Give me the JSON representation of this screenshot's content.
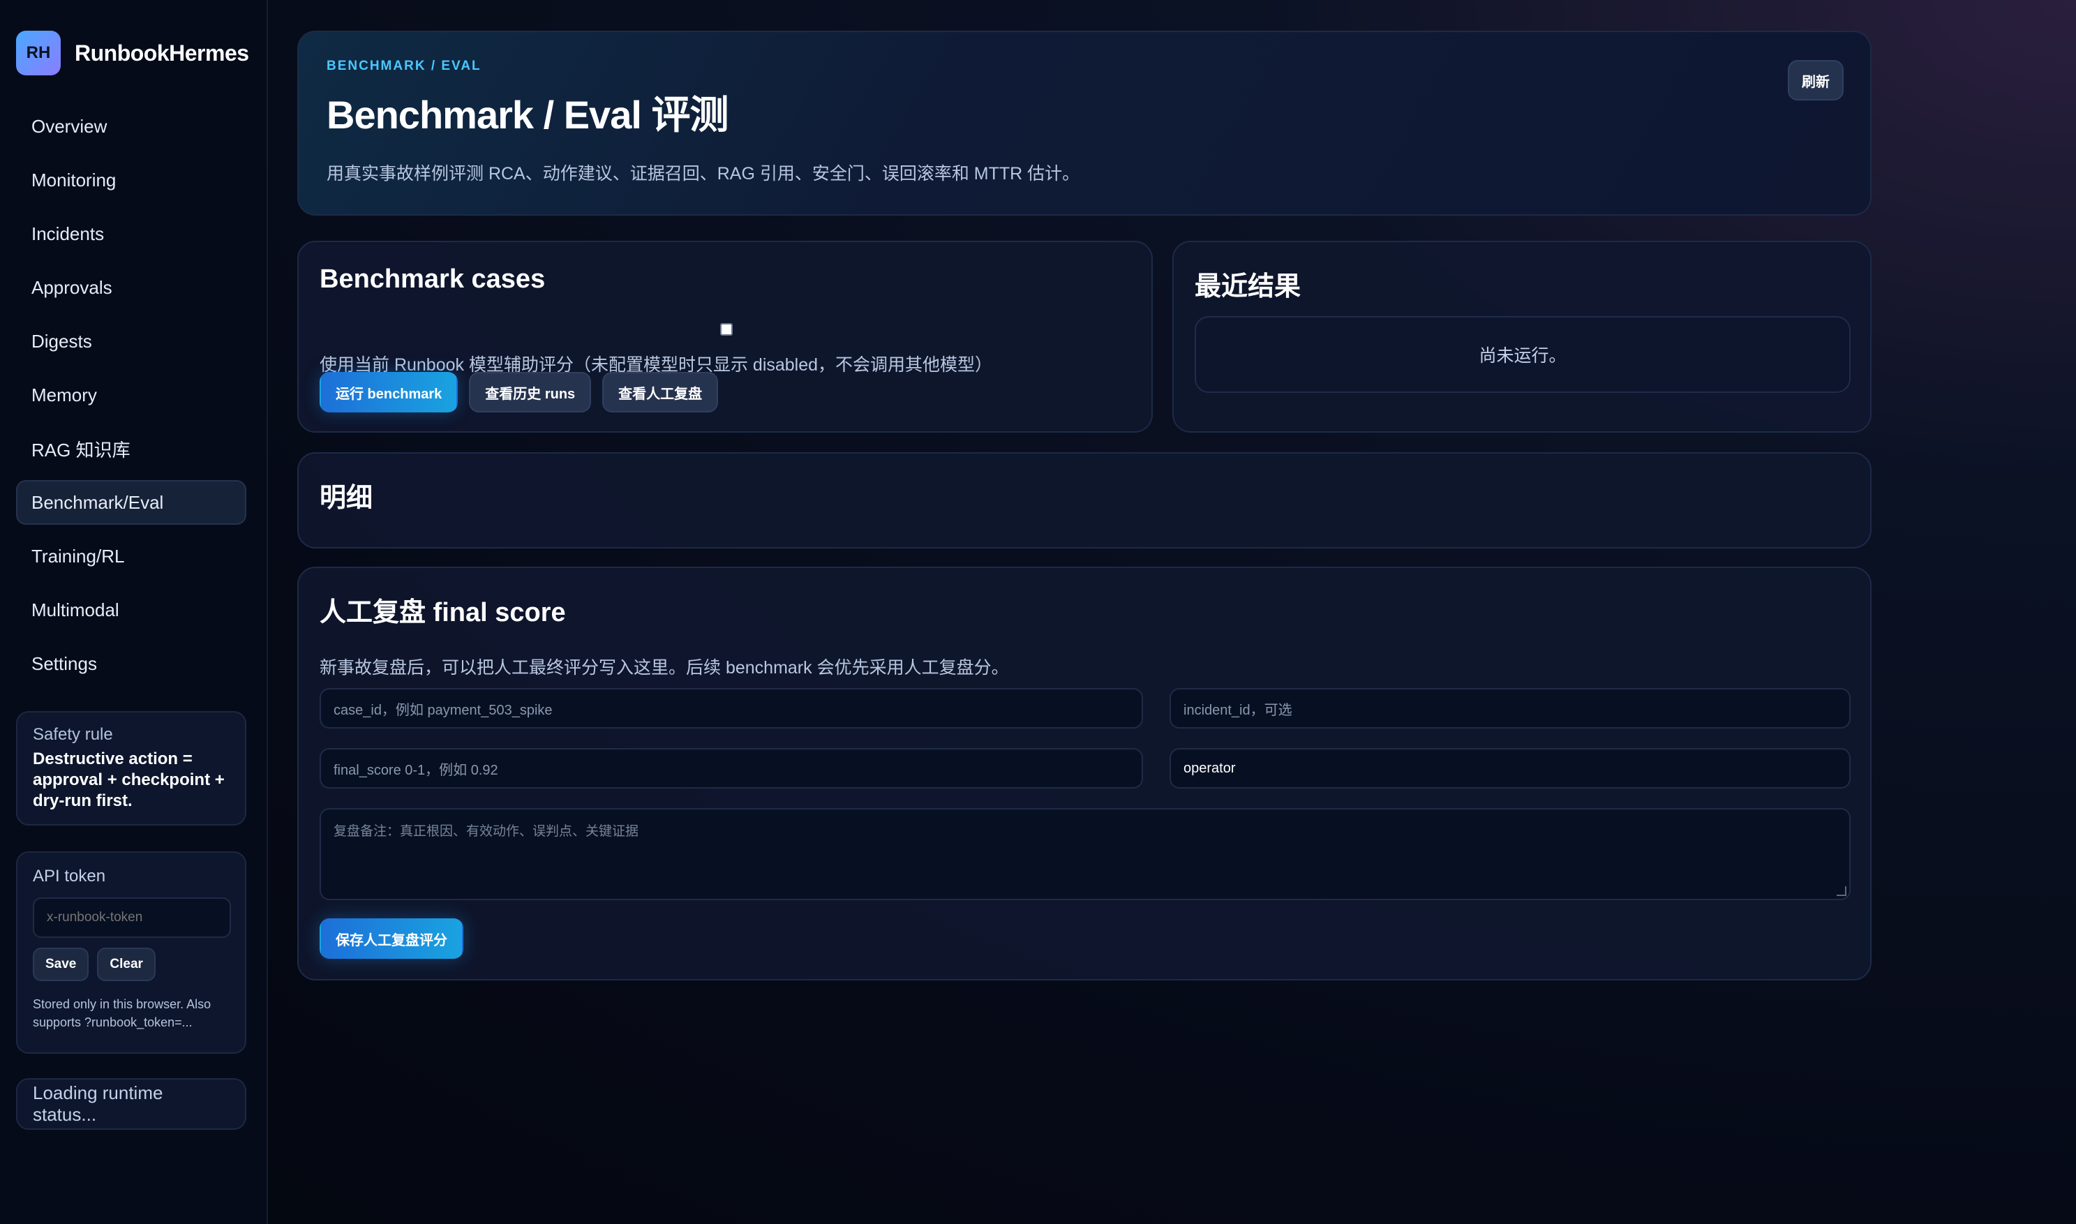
{
  "brand": {
    "logo": "RH",
    "name": "RunbookHermes"
  },
  "nav": [
    {
      "label": "Overview",
      "active": false
    },
    {
      "label": "Monitoring",
      "active": false
    },
    {
      "label": "Incidents",
      "active": false
    },
    {
      "label": "Approvals",
      "active": false
    },
    {
      "label": "Digests",
      "active": false
    },
    {
      "label": "Memory",
      "active": false
    },
    {
      "label": "RAG 知识库",
      "active": false
    },
    {
      "label": "Benchmark/Eval",
      "active": true
    },
    {
      "label": "Training/RL",
      "active": false
    },
    {
      "label": "Multimodal",
      "active": false
    },
    {
      "label": "Settings",
      "active": false
    }
  ],
  "safety": {
    "title": "Safety rule",
    "text": "Destructive action = approval + checkpoint + dry-run first."
  },
  "api": {
    "title": "API token",
    "placeholder": "x-runbook-token",
    "save_label": "Save",
    "clear_label": "Clear",
    "note": "Stored only in this browser. Also supports ?runbook_token=..."
  },
  "status": {
    "text": "Loading runtime status..."
  },
  "hero": {
    "eyebrow": "BENCHMARK / EVAL",
    "title": "Benchmark / Eval 评测",
    "subtitle": "用真实事故样例评测 RCA、动作建议、证据召回、RAG 引用、安全门、误回滚率和 MTTR 估计。",
    "refresh_label": "刷新"
  },
  "cases": {
    "title": "Benchmark cases",
    "checkbox_checked": false,
    "note": "使用当前 Runbook 模型辅助评分（未配置模型时只显示 disabled，不会调用其他模型）",
    "run_label": "运行 benchmark",
    "history_label": "查看历史 runs",
    "manual_label": "查看人工复盘"
  },
  "recent": {
    "title": "最近结果",
    "empty_text": "尚未运行。"
  },
  "detail": {
    "title": "明细"
  },
  "review": {
    "title": "人工复盘 final score",
    "note": "新事故复盘后，可以把人工最终评分写入这里。后续 benchmark 会优先采用人工复盘分。",
    "case_id_placeholder": "case_id，例如 payment_503_spike",
    "incident_id_placeholder": "incident_id，可选",
    "final_score_placeholder": "final_score 0-1，例如 0.92",
    "reviewer_value": "operator",
    "notes_placeholder": "复盘备注：真正根因、有效动作、误判点、关键证据",
    "save_label": "保存人工复盘评分"
  },
  "icons": {
    "textarea_resize": "resize-grip-icon"
  },
  "colors": {
    "accent": "#4ac8ff",
    "primary_button": "#1d6fd8",
    "background": "#060a17"
  }
}
